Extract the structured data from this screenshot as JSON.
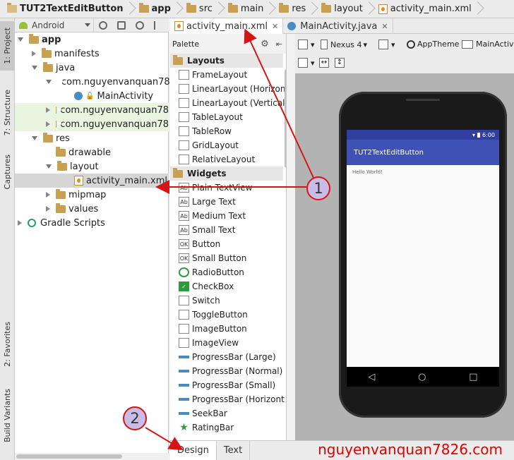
{
  "breadcrumb": [
    "TUT2TextEditButton",
    "app",
    "src",
    "main",
    "res",
    "layout",
    "activity_main.xml"
  ],
  "left_tools": {
    "project": "1: Project",
    "structure": "7: Structure",
    "captures": "Captures",
    "favorites": "2: Favorites",
    "build_variants": "Build Variants"
  },
  "project_panel": {
    "view_mode": "Android"
  },
  "tree": {
    "app": "app",
    "manifests": "manifests",
    "java": "java",
    "pkg1": "com.nguyenvanquan78",
    "main_activity": "MainActivity",
    "pkg2": "com.nguyenvanquan78",
    "pkg3": "com.nguyenvanquan78",
    "res": "res",
    "drawable": "drawable",
    "layout": "layout",
    "activity_main": "activity_main.xml",
    "mipmap": "mipmap",
    "values": "values",
    "gradle": "Gradle Scripts"
  },
  "editor_tabs": [
    {
      "label": "activity_main.xml",
      "active": true
    },
    {
      "label": "MainActivity.java",
      "active": false
    }
  ],
  "palette": {
    "title": "Palette",
    "cat_layouts": "Layouts",
    "layouts": [
      "FrameLayout",
      "LinearLayout (Horizon",
      "LinearLayout (Vertical",
      "TableLayout",
      "TableRow",
      "GridLayout",
      "RelativeLayout"
    ],
    "cat_widgets": "Widgets",
    "widgets": [
      "Plain TextView",
      "Large Text",
      "Medium Text",
      "Small Text",
      "Button",
      "Small Button",
      "RadioButton",
      "CheckBox",
      "Switch",
      "ToggleButton",
      "ImageButton",
      "ImageView",
      "ProgressBar (Large)",
      "ProgressBar (Normal)",
      "ProgressBar (Small)",
      "ProgressBar (Horizont",
      "SeekBar",
      "RatingBar"
    ]
  },
  "design_toolbar": {
    "device": "Nexus 4",
    "theme": "AppTheme",
    "activity": "MainActivity"
  },
  "preview": {
    "time": "6:00",
    "app_title": "TUT2TextEditButton",
    "hello": "Hello World!",
    "colors": {
      "statusbar": "#303f9f",
      "appbar": "#3f51b5"
    }
  },
  "bottom_tabs": {
    "design": "Design",
    "text": "Text"
  },
  "watermark": "nguyenvanquan7826.com",
  "annotations": {
    "one": "1",
    "two": "2"
  }
}
